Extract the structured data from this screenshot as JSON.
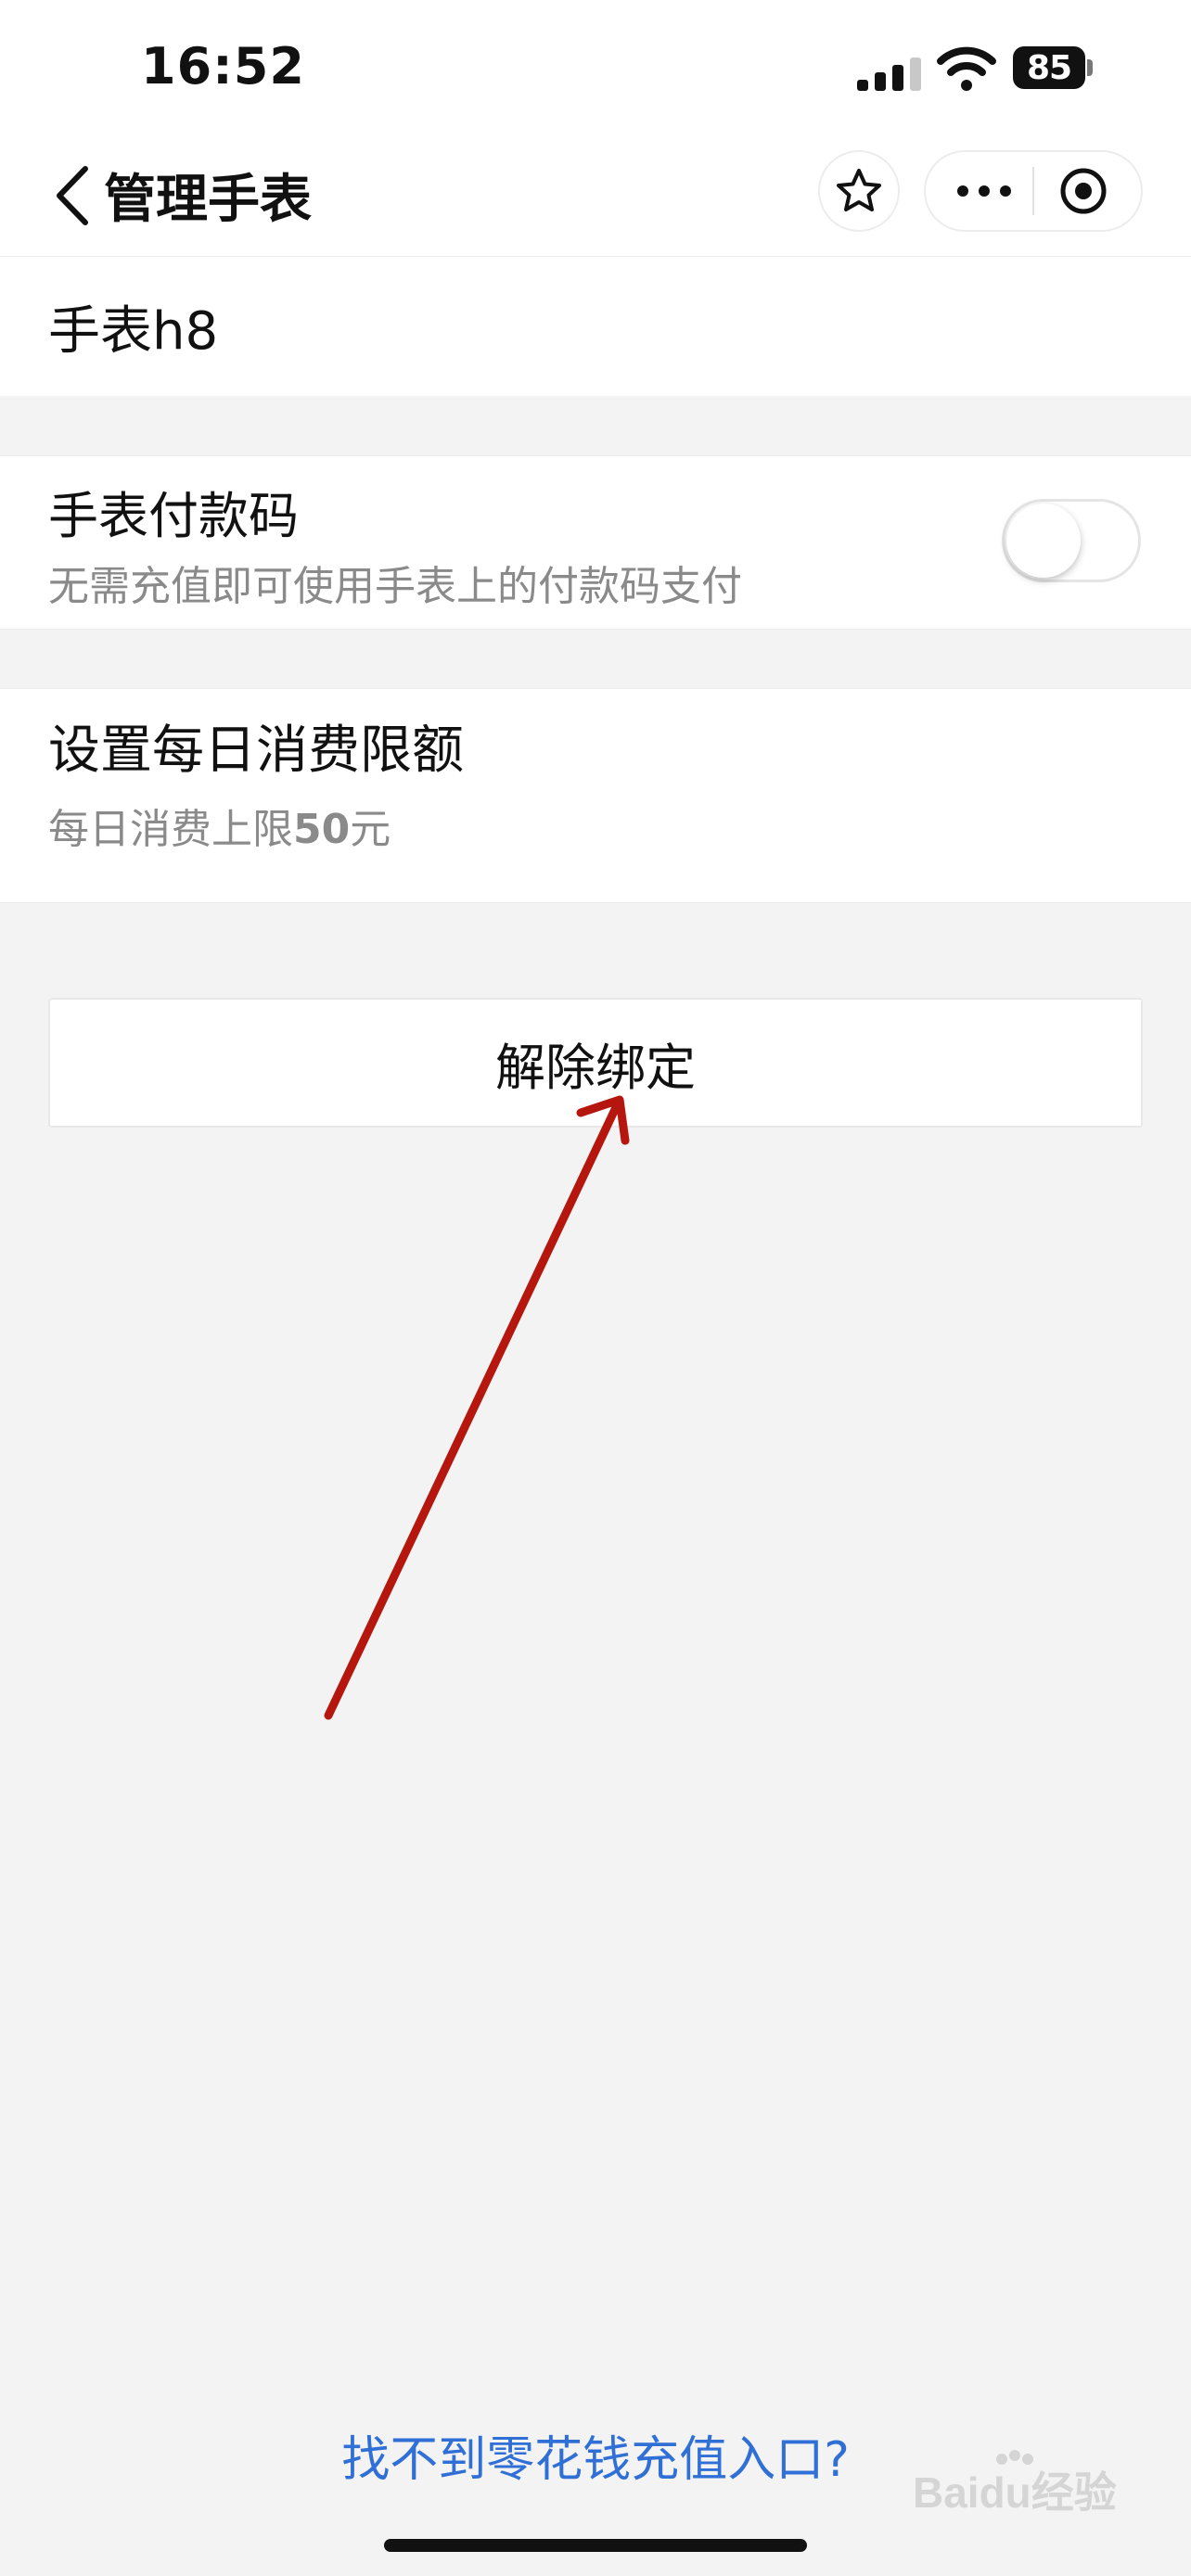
{
  "status_bar": {
    "time": "16:52",
    "battery": "85"
  },
  "nav": {
    "title": "管理手表",
    "icons": [
      "back-icon",
      "star-icon",
      "more-icon",
      "target-icon"
    ]
  },
  "device": {
    "name": "手表h8"
  },
  "payment_code": {
    "title": "手表付款码",
    "description": "无需充值即可使用手表上的付款码支付",
    "enabled": false
  },
  "daily_limit": {
    "title": "设置每日消费限额",
    "description_prefix": "每日消费上限",
    "amount": "50",
    "unit": "元"
  },
  "unbind_button": {
    "label": "解除绑定"
  },
  "bottom_link": {
    "text": "找不到零花钱充值入口?"
  },
  "watermark": {
    "text": "Baidu经验"
  },
  "colors": {
    "accent": "#2f6fd6",
    "annotation_arrow": "#b5160e",
    "background": "#f3f3f3"
  }
}
